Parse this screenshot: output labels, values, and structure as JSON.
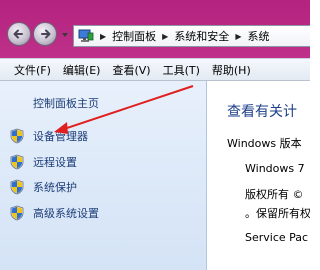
{
  "address_bar": {
    "breadcrumbs": [
      "控制面板",
      "系统和安全",
      "系统"
    ]
  },
  "menu": {
    "items": [
      "文件(F)",
      "编辑(E)",
      "查看(V)",
      "工具(T)",
      "帮助(H)"
    ]
  },
  "left_pane": {
    "home_link": "控制面板主页",
    "tasks": [
      "设备管理器",
      "远程设置",
      "系统保护",
      "高级系统设置"
    ]
  },
  "right_pane": {
    "heading": "查看有关计",
    "edition_label": "Windows 版本",
    "windows_name": "Windows 7",
    "copyright_line1": "版权所有 ©",
    "copyright_line2": "。保留所有权",
    "service_pack": "Service Pac"
  },
  "annotation": {
    "arrow_color": "#e0201f"
  },
  "icons": {
    "back": "back-arrow-icon",
    "forward": "forward-arrow-icon",
    "address": "computer-icon",
    "task": "uac-shield-icon"
  }
}
